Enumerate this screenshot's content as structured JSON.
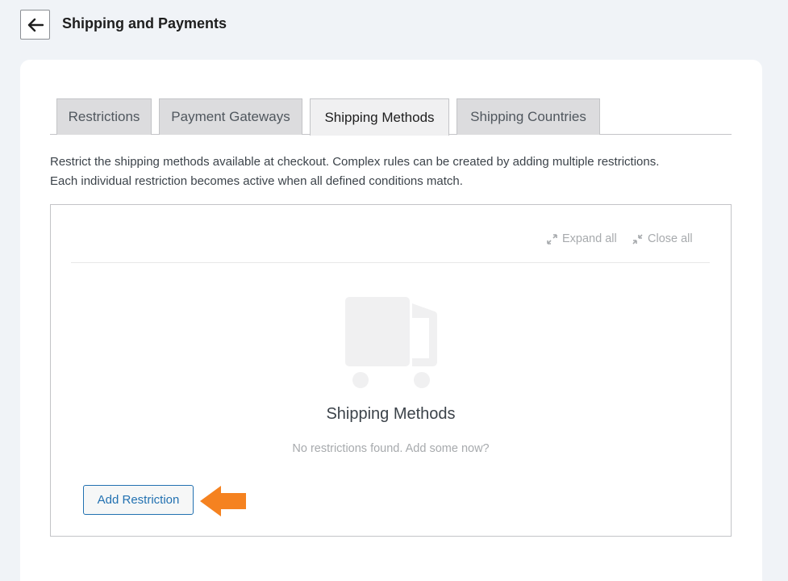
{
  "header": {
    "title": "Shipping and Payments",
    "back_icon": "arrow-left-icon"
  },
  "tabs": [
    {
      "label": "Restrictions",
      "active": false
    },
    {
      "label": "Payment Gateways",
      "active": false
    },
    {
      "label": "Shipping Methods",
      "active": true
    },
    {
      "label": "Shipping Countries",
      "active": false
    }
  ],
  "description": {
    "line1": "Restrict the shipping methods available at checkout. Complex rules can be created by adding multiple restrictions.",
    "line2": "Each individual restriction becomes active when all defined conditions match."
  },
  "panel": {
    "expand_all": "Expand all",
    "close_all": "Close all",
    "empty_icon": "truck-icon",
    "empty_title": "Shipping Methods",
    "empty_subtitle": "No restrictions found. Add some now?",
    "add_button": "Add Restriction"
  },
  "colors": {
    "accent": "#2271b1",
    "callout_arrow": "#f58220"
  }
}
